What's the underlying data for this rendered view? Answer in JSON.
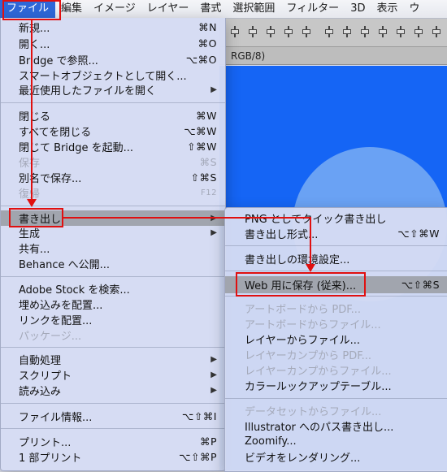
{
  "menubar": {
    "items": [
      "ファイル",
      "編集",
      "イメージ",
      "レイヤー",
      "書式",
      "選択範囲",
      "フィルター",
      "3D",
      "表示",
      "ウ"
    ]
  },
  "document": {
    "tab_title": "RGB/8)"
  },
  "file_menu": {
    "items": [
      {
        "label": "新規...",
        "shortcut": "⌘N"
      },
      {
        "label": "開く...",
        "shortcut": "⌘O"
      },
      {
        "label": "Bridge で参照...",
        "shortcut": "⌥⌘O"
      },
      {
        "label": "スマートオブジェクトとして開く...",
        "shortcut": ""
      },
      {
        "label": "最近使用したファイルを開く",
        "shortcut": "▶"
      },
      {
        "label": "閉じる",
        "shortcut": "⌘W"
      },
      {
        "label": "すべてを閉じる",
        "shortcut": "⌥⌘W"
      },
      {
        "label": "閉じて Bridge を起動...",
        "shortcut": "⇧⌘W"
      },
      {
        "label": "保存",
        "shortcut": "⌘S"
      },
      {
        "label": "別名で保存...",
        "shortcut": "⇧⌘S"
      },
      {
        "label": "復帰",
        "shortcut": "F12"
      },
      {
        "label": "書き出し",
        "shortcut": "▶"
      },
      {
        "label": "生成",
        "shortcut": "▶"
      },
      {
        "label": "共有...",
        "shortcut": ""
      },
      {
        "label": "Behance へ公開...",
        "shortcut": ""
      },
      {
        "label": "Adobe Stock を検索...",
        "shortcut": ""
      },
      {
        "label": "埋め込みを配置...",
        "shortcut": ""
      },
      {
        "label": "リンクを配置...",
        "shortcut": ""
      },
      {
        "label": "パッケージ...",
        "shortcut": ""
      },
      {
        "label": "自動処理",
        "shortcut": "▶"
      },
      {
        "label": "スクリプト",
        "shortcut": "▶"
      },
      {
        "label": "読み込み",
        "shortcut": "▶"
      },
      {
        "label": "ファイル情報...",
        "shortcut": "⌥⇧⌘I"
      },
      {
        "label": "プリント...",
        "shortcut": "⌘P"
      },
      {
        "label": "1 部プリント",
        "shortcut": "⌥⇧⌘P"
      }
    ]
  },
  "export_menu": {
    "items": [
      {
        "label": "PNG としてクイック書き出し",
        "shortcut": ""
      },
      {
        "label": "書き出し形式...",
        "shortcut": "⌥⇧⌘W"
      },
      {
        "label": "書き出しの環境設定...",
        "shortcut": ""
      },
      {
        "label": "Web 用に保存 (従来)...",
        "shortcut": "⌥⇧⌘S"
      },
      {
        "label": "アートボードから PDF...",
        "shortcut": ""
      },
      {
        "label": "アートボードからファイル...",
        "shortcut": ""
      },
      {
        "label": "レイヤーからファイル...",
        "shortcut": ""
      },
      {
        "label": "レイヤーカンプから PDF...",
        "shortcut": ""
      },
      {
        "label": "レイヤーカンプからファイル...",
        "shortcut": ""
      },
      {
        "label": "カラールックアップテーブル...",
        "shortcut": ""
      },
      {
        "label": "データセットからファイル...",
        "shortcut": ""
      },
      {
        "label": "Illustrator へのパス書き出し...",
        "shortcut": ""
      },
      {
        "label": "Zoomify...",
        "shortcut": ""
      },
      {
        "label": "ビデオをレンダリング...",
        "shortcut": ""
      }
    ]
  },
  "colors": {
    "annotation_red": "#e01010",
    "menu_highlight": "#a1a5ae",
    "canvas_blue": "#1565f5",
    "circle_blue": "#6aa2f4"
  }
}
